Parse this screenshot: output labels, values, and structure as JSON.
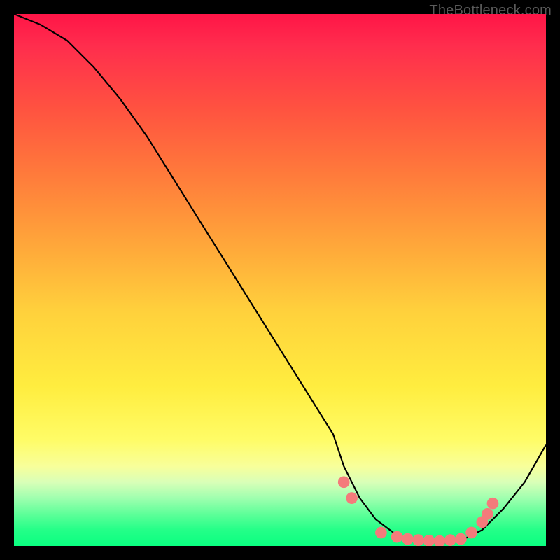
{
  "attribution": "TheBottleneck.com",
  "chart_data": {
    "type": "line",
    "title": "",
    "xlabel": "",
    "ylabel": "",
    "x_range": [
      0,
      100
    ],
    "y_range": [
      0,
      100
    ],
    "curve": {
      "x": [
        0,
        5,
        10,
        15,
        20,
        25,
        30,
        35,
        40,
        45,
        50,
        55,
        60,
        62,
        65,
        68,
        72,
        76,
        80,
        84,
        88,
        92,
        96,
        100
      ],
      "y": [
        100,
        98,
        95,
        90,
        84,
        77,
        69,
        61,
        53,
        45,
        37,
        29,
        21,
        15,
        9,
        5,
        2,
        1,
        0.5,
        1,
        3,
        7,
        12,
        19
      ]
    },
    "markers": {
      "x": [
        62,
        63.5,
        69,
        72,
        74,
        76,
        78,
        80,
        82,
        84,
        86,
        88,
        89,
        90
      ],
      "y": [
        12,
        9,
        2.5,
        1.7,
        1.3,
        1.1,
        1.0,
        0.9,
        1.1,
        1.3,
        2.5,
        4.5,
        6,
        8
      ]
    },
    "marker_color": "#f47b7b",
    "line_color": "#000000"
  }
}
